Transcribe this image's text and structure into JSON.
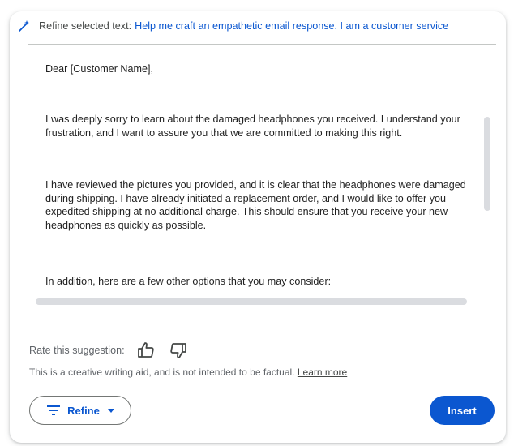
{
  "header": {
    "icon": "magic-wand-icon",
    "prefix": "Refine selected text:",
    "prompt": "Help me craft an empathetic email response. I am a customer service"
  },
  "content": {
    "paragraphs": [
      "Dear [Customer Name],",
      "I was deeply sorry to learn about the damaged headphones you received. I understand your frustration, and I want to assure you that we are committed to making this right.",
      "I have reviewed the pictures you provided, and it is clear that the headphones were damaged during shipping. I have already initiated a replacement order, and I would like to offer you expedited shipping at no additional charge. This should ensure that you receive your new headphones as quickly as possible.",
      "In addition, here are a few other options that you may consider:"
    ]
  },
  "feedback": {
    "label": "Rate this suggestion:",
    "thumbs_up_icon": "thumbs-up-icon",
    "thumbs_down_icon": "thumbs-down-icon"
  },
  "disclaimer": {
    "text": "This is a creative writing aid, and is not intended to be factual.",
    "link": "Learn more"
  },
  "actions": {
    "refine_label": "Refine",
    "insert_label": "Insert"
  },
  "colors": {
    "accent": "#0b57d0",
    "text": "#1f1f1f",
    "muted": "#5f6368"
  }
}
